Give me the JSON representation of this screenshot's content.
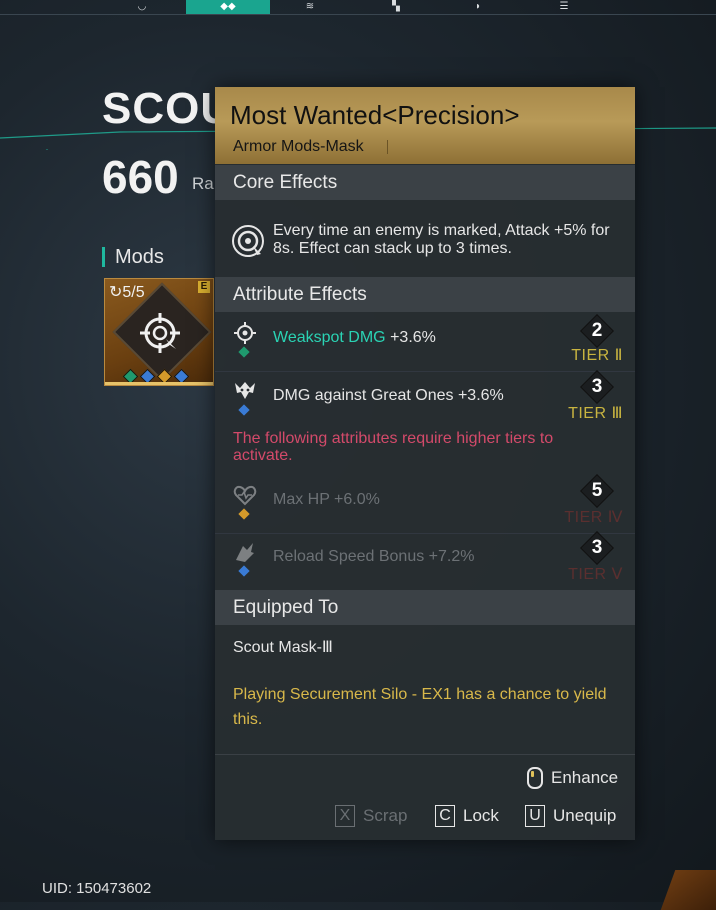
{
  "top_nav": {
    "tabs": [
      {
        "icon": "helmet-icon",
        "active": false
      },
      {
        "icon": "mask-icon",
        "active": true
      },
      {
        "icon": "gloves-icon",
        "active": false
      },
      {
        "icon": "armor-icon",
        "active": false
      },
      {
        "icon": "boots-icon",
        "active": false
      },
      {
        "icon": "bars-icon",
        "active": false
      }
    ]
  },
  "item": {
    "name": "SCOUT MASK",
    "rating": "660",
    "rating_suffix": "Ra",
    "mods_label": "Mods",
    "mod_card": {
      "uses": "5/5",
      "grade": "E",
      "socket_colors": [
        "#1f9a6e",
        "#3a7bd5",
        "#d49a2a",
        "#3a7bd5"
      ]
    }
  },
  "uid": "UID: 150473602",
  "tooltip": {
    "title": "Most Wanted<Precision>",
    "subtitle": "Armor Mods-Mask",
    "core_header": "Core Effects",
    "core_text": "Every time an enemy is marked, Attack +5% for 8s. Effect can stack up to 3 times.",
    "attr_header": "Attribute Effects",
    "attributes": [
      {
        "icon": "crosshair-icon",
        "highlight": "Weakspot DMG",
        "text": " +3.6%",
        "tier_num": "2",
        "tier_label": "TIER Ⅱ",
        "dot_color": "#1f9a6e",
        "locked": false
      },
      {
        "icon": "beast-icon",
        "highlight": "",
        "text": "DMG against Great Ones +3.6%",
        "tier_num": "3",
        "tier_label": "TIER Ⅲ",
        "dot_color": "#3a7bd5",
        "locked": false
      }
    ],
    "warning": "The following attributes require higher tiers to activate.",
    "locked_attributes": [
      {
        "icon": "heartbeat-icon",
        "text": "Max HP +6.0%",
        "tier_num": "5",
        "tier_label": "TIER Ⅳ",
        "dot_color": "#d49a2a"
      },
      {
        "icon": "reload-icon",
        "text": "Reload Speed Bonus +7.2%",
        "tier_num": "3",
        "tier_label": "TIER Ⅴ",
        "dot_color": "#3a7bd5"
      }
    ],
    "equipped_header": "Equipped To",
    "equipped_to": "Scout Mask-Ⅲ",
    "source": "Playing Securement Silo - EX1 has a chance to yield this.",
    "enhance_label": "Enhance",
    "actions": {
      "scrap_key": "X",
      "scrap_label": "Scrap",
      "lock_key": "C",
      "lock_label": "Lock",
      "unequip_key": "U",
      "unequip_label": "Unequip"
    }
  }
}
